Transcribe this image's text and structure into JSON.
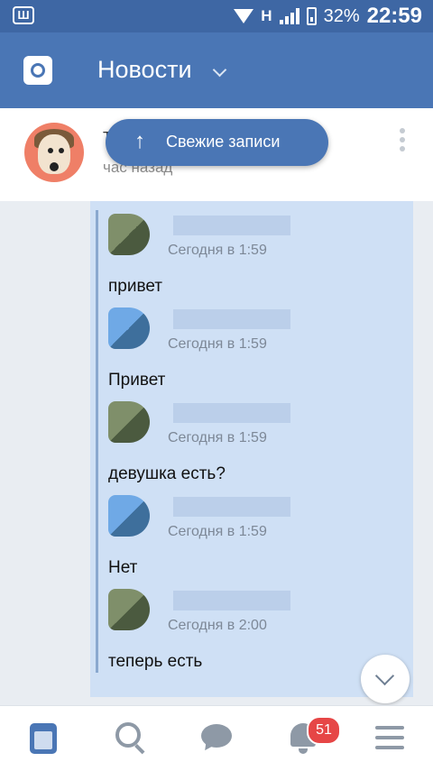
{
  "status_bar": {
    "network": "H",
    "battery": "32%",
    "time": "22:59"
  },
  "app_bar": {
    "title": "Новости"
  },
  "post": {
    "name": "T",
    "time": "час назад"
  },
  "fresh_button": {
    "label": "Свежие записи",
    "arrow": "↑"
  },
  "messages": [
    {
      "time": "Сегодня в 1:59",
      "text": "привет"
    },
    {
      "time": "Сегодня в 1:59",
      "text": "Привет"
    },
    {
      "time": "Сегодня в 1:59",
      "text": "девушка есть?"
    },
    {
      "time": "Сегодня в 1:59",
      "text": "Нет"
    },
    {
      "time": "Сегодня в 2:00",
      "text": "теперь есть"
    }
  ],
  "bottom_nav": {
    "notifications_count": "51"
  },
  "colors": {
    "status_bar": "#3e67a4",
    "app_bar": "#4a76b5",
    "card": "#cfe0f5",
    "badge": "#e64646"
  },
  "icons": [
    "camera-icon",
    "chevron-down-icon",
    "more-vert-icon",
    "arrow-up-icon",
    "news-icon",
    "search-icon",
    "chat-icon",
    "bell-icon",
    "menu-icon"
  ]
}
